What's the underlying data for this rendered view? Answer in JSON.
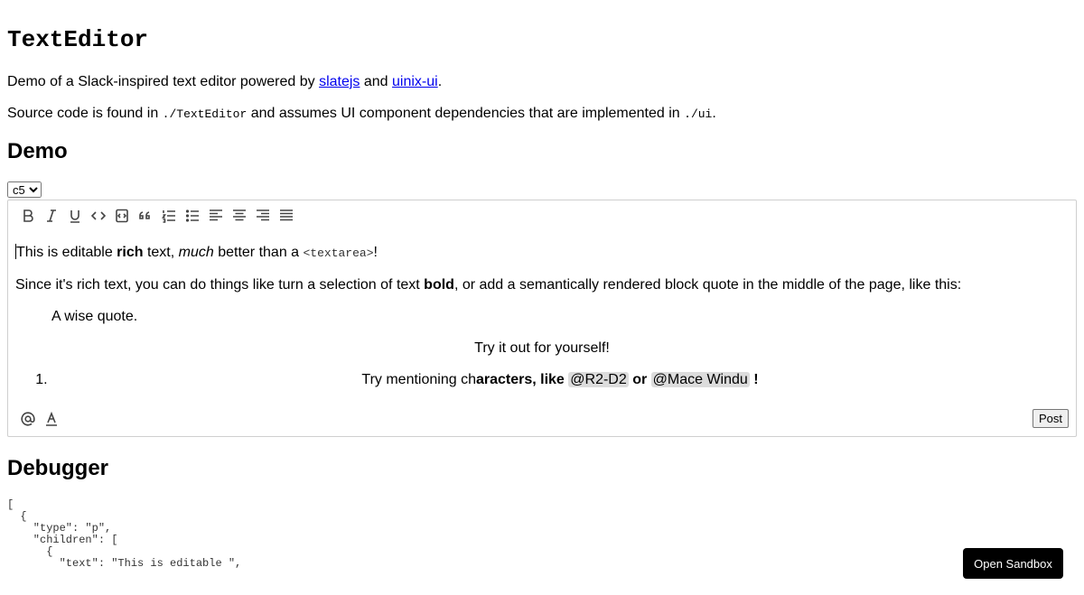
{
  "header": {
    "title": "TextEditor",
    "intro_prefix": "Demo of a Slack-inspired text editor powered by ",
    "link_slatejs": "slatejs",
    "intro_and": " and ",
    "link_uinix": "uinix-ui",
    "intro_suffix": ".",
    "source_prefix": "Source code is found in ",
    "source_path1": "./TextEditor",
    "source_middle": " and assumes UI component dependencies that are implemented in ",
    "source_path2": "./ui",
    "source_suffix": "."
  },
  "demo": {
    "heading": "Demo",
    "variant_selected": "c5"
  },
  "toolbar": {
    "buttons": [
      "bold-icon",
      "italic-icon",
      "underline-icon",
      "code-icon",
      "code-block-icon",
      "quote-icon",
      "ordered-list-icon",
      "bulleted-list-icon",
      "align-left-icon",
      "align-center-icon",
      "align-right-icon",
      "align-justify-icon"
    ]
  },
  "editor": {
    "p1": {
      "a": "This is editable ",
      "b": "rich",
      "c": " text, ",
      "d": "much",
      "e": " better than a ",
      "code": "<textarea>",
      "f": "!"
    },
    "p2": {
      "a": "Since it's rich text, you can do things like turn a selection of text ",
      "b": "bold",
      "c": ", or add a semantically rendered block quote in the middle of the page, like this:"
    },
    "quote": "A wise quote.",
    "center_text": "Try it out for yourself!",
    "list_item": {
      "a": "Try mentioning ch",
      "b": "aracters, like ",
      "mention1": "@R2-D2",
      "c": " or ",
      "mention2": "@Mace Windu",
      "d": " !"
    },
    "post_label": "Post"
  },
  "debugger": {
    "heading": "Debugger",
    "json_preview": "[\n  {\n    \"type\": \"p\",\n    \"children\": [\n      {\n        \"text\": \"This is editable \","
  },
  "sandbox_label": "Open Sandbox"
}
